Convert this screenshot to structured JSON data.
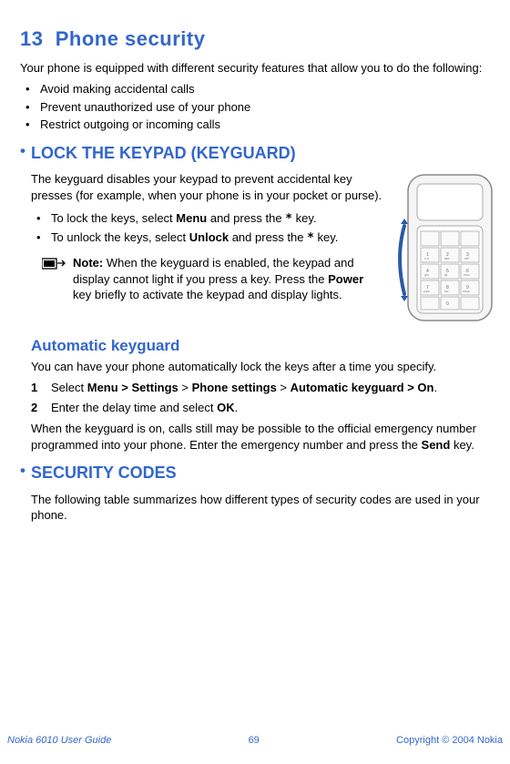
{
  "chapter": {
    "number": "13",
    "title": "Phone security"
  },
  "intro": "Your phone is equipped with different security features that allow you to do the following:",
  "features": [
    "Avoid making accidental calls",
    "Prevent unauthorized use of your phone",
    "Restrict outgoing or incoming calls"
  ],
  "keyguard": {
    "heading": "LOCK THE KEYPAD (KEYGUARD)",
    "desc": "The keyguard disables your keypad to prevent accidental key presses (for example, when your phone is in your pocket or purse).",
    "lock_prefix": "To lock the keys, select ",
    "lock_bold": "Menu",
    "lock_mid": " and press the ",
    "lock_suffix": " key.",
    "unlock_prefix": "To unlock the keys, select ",
    "unlock_bold": "Unlock",
    "unlock_mid": " and press the ",
    "unlock_suffix": " key.",
    "note_label": "Note:",
    "note_part1": " When the keyguard is enabled, the keypad and display cannot light if you press a key. Press the ",
    "note_bold": "Power",
    "note_part2": " key briefly to activate the keypad and display lights."
  },
  "auto": {
    "heading": "Automatic keyguard",
    "desc": "You can have your phone automatically lock the keys after a time you specify.",
    "step1_pre": "Select ",
    "step1_b1": "Menu > Settings",
    "step1_m1": " > ",
    "step1_b2": "Phone settings",
    "step1_m2": " > ",
    "step1_b3": "Automatic keyguard > On",
    "step1_suf": ".",
    "step2_pre": "Enter the delay time and select ",
    "step2_b": "OK",
    "step2_suf": ".",
    "emergency_pre": "When the keyguard is on, calls still may be possible to the official emergency number programmed into your phone. Enter the emergency number and press the ",
    "emergency_bold": "Send",
    "emergency_suf": " key."
  },
  "codes": {
    "heading": "SECURITY CODES",
    "desc": "The following table summarizes how different types of security codes are used in your phone."
  },
  "footer": {
    "left": "Nokia 6010 User Guide",
    "center": "69",
    "right": "Copyright © 2004 Nokia"
  },
  "star": "*"
}
